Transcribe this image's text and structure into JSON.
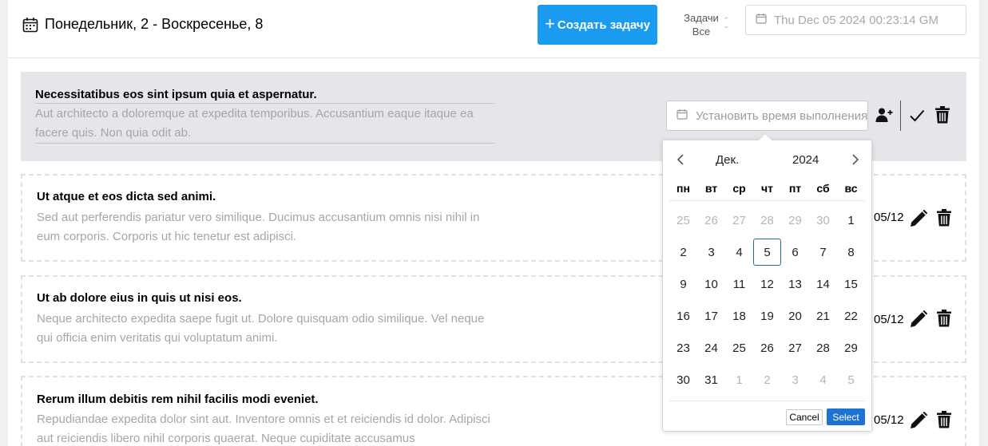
{
  "header": {
    "week_range": "Понедельник, 2 - Воскресенье, 8",
    "create_button": "Создать задачу",
    "filter_label": "Задачи",
    "filter_value": "Все",
    "date_input_value": "Thu Dec 05 2024 00:23:14 GM"
  },
  "tasks": [
    {
      "title": "Necessitatibus eos sint ipsum quia et aspernatur.",
      "description": "Aut architecto a doloremque at expedita temporibus. Accusantium eaque itaque ea facere quis. Non quia odit ab.",
      "time_placeholder": "Установить время выполнения"
    },
    {
      "title": "Ut atque et eos dicta sed animi.",
      "description": "Sed aut perferendis pariatur vero similique. Ducimus accusantium omnis nisi nihil in eum corporis. Corporis ut hic tenetur est adipisci.",
      "due": "05/12"
    },
    {
      "title": "Ut ab dolore eius in quis ut nisi eos.",
      "description": "Neque architecto expedita saepe fugit ut. Dolore quisquam odio similique. Vel neque qui officia enim veritatis qui voluptatum animi.",
      "due": "05/12"
    },
    {
      "title": "Rerum illum debitis rem nihil facilis modi eveniet.",
      "description": "Repudiandae expedita dolor sint aut. Inventore omnis et et reiciendis id dolor. Adipisci aut reiciendis libero nihil corporis quaerat. Neque cupiditate accusamus",
      "due": "05/12"
    }
  ],
  "calendar": {
    "month": "Дек.",
    "year": "2024",
    "weekdays": [
      "пн",
      "вт",
      "ср",
      "чт",
      "пт",
      "сб",
      "вс"
    ],
    "days": [
      {
        "d": "25",
        "muted": true
      },
      {
        "d": "26",
        "muted": true
      },
      {
        "d": "27",
        "muted": true
      },
      {
        "d": "28",
        "muted": true
      },
      {
        "d": "29",
        "muted": true
      },
      {
        "d": "30",
        "muted": true
      },
      {
        "d": "1"
      },
      {
        "d": "2"
      },
      {
        "d": "3"
      },
      {
        "d": "4"
      },
      {
        "d": "5",
        "selected": true
      },
      {
        "d": "6"
      },
      {
        "d": "7"
      },
      {
        "d": "8"
      },
      {
        "d": "9"
      },
      {
        "d": "10"
      },
      {
        "d": "11"
      },
      {
        "d": "12"
      },
      {
        "d": "13"
      },
      {
        "d": "14"
      },
      {
        "d": "15"
      },
      {
        "d": "16"
      },
      {
        "d": "17"
      },
      {
        "d": "18"
      },
      {
        "d": "19"
      },
      {
        "d": "20"
      },
      {
        "d": "21"
      },
      {
        "d": "22"
      },
      {
        "d": "23"
      },
      {
        "d": "24"
      },
      {
        "d": "25"
      },
      {
        "d": "26"
      },
      {
        "d": "27"
      },
      {
        "d": "28"
      },
      {
        "d": "29"
      },
      {
        "d": "30"
      },
      {
        "d": "31"
      },
      {
        "d": "1",
        "muted": true
      },
      {
        "d": "2",
        "muted": true
      },
      {
        "d": "3",
        "muted": true
      },
      {
        "d": "4",
        "muted": true
      },
      {
        "d": "5",
        "muted": true
      }
    ],
    "cancel_label": "Cancel",
    "select_label": "Select"
  },
  "icons": {
    "week": "calendar-icon",
    "create": "plus-icon",
    "filter": "sort-chevrons-icon",
    "date_input": "calendar-icon",
    "assign": "add-user-icon",
    "complete": "check-icon",
    "delete": "trash-icon",
    "edit": "pencil-icon",
    "prev": "chevron-left-icon",
    "next": "chevron-right-icon"
  },
  "colors": {
    "primary": "#1a9bf0",
    "active_task_bg": "#e5e6ea",
    "select_button": "#1e73d2",
    "selected_day_border": "#1f6f9a"
  }
}
